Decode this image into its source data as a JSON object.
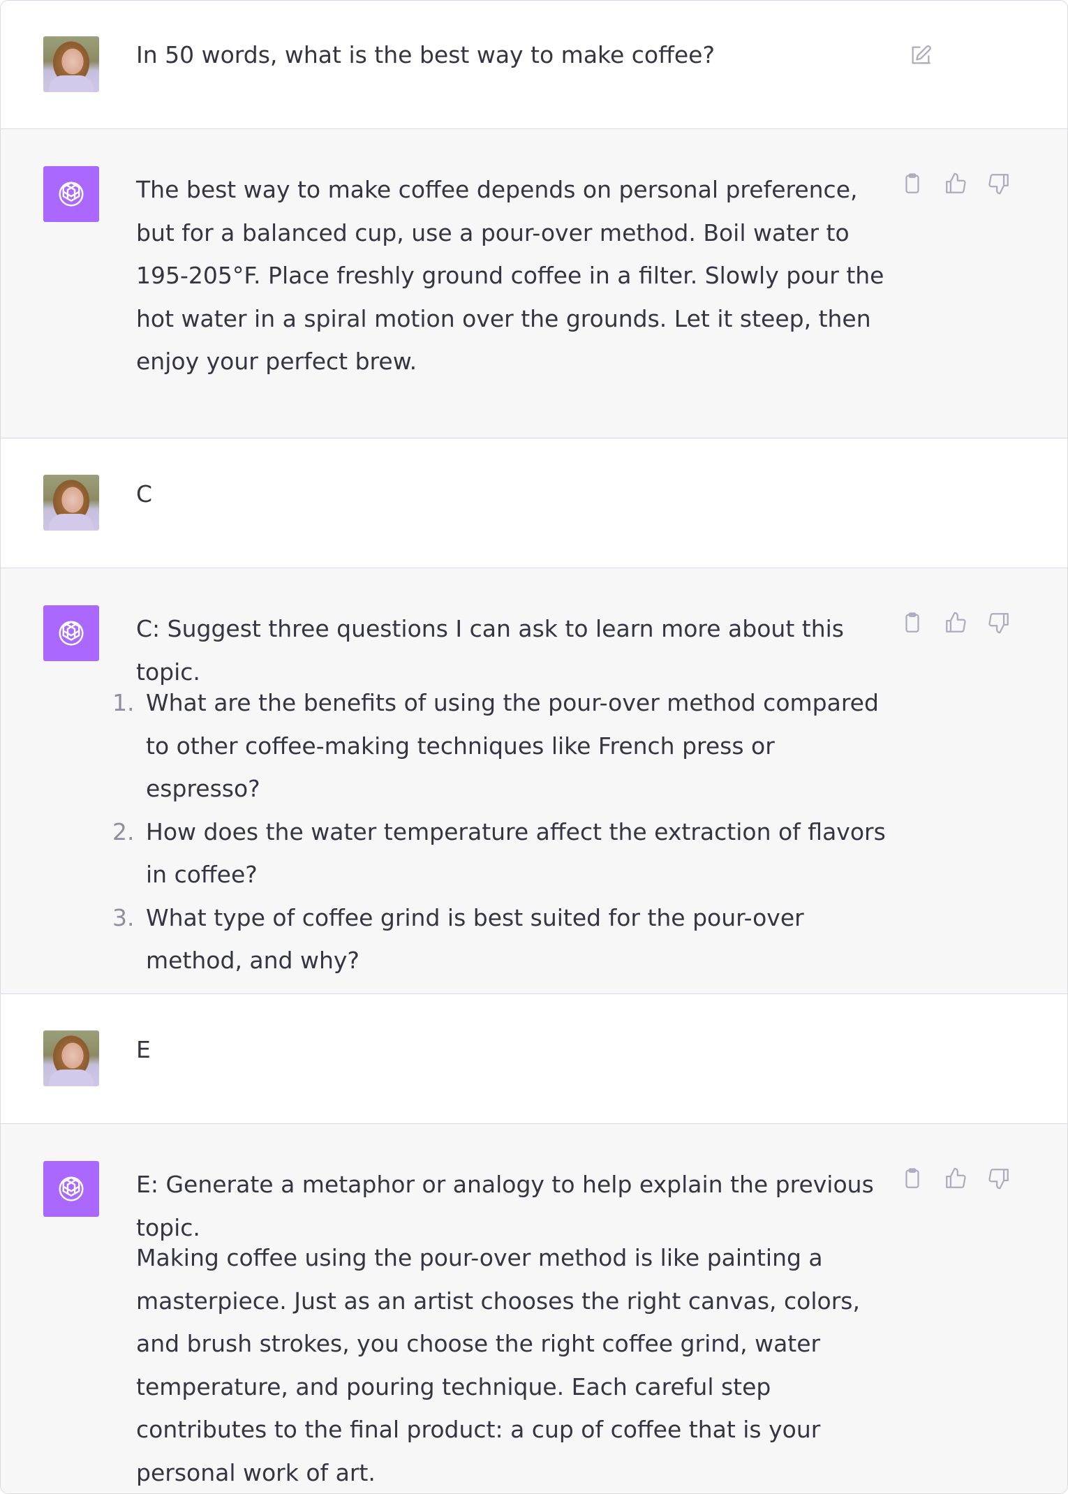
{
  "conversation": [
    {
      "role": "user",
      "text": "In 50 words, what is the best way to make coffee?"
    },
    {
      "role": "assistant",
      "text": "The best way to make coffee depends on personal preference, but for a balanced cup, use a pour-over method. Boil water to 195-205°F. Place freshly ground coffee in a filter. Slowly pour the hot water in a spiral motion over the grounds. Let it steep, then enjoy your perfect brew."
    },
    {
      "role": "user",
      "text": "C"
    },
    {
      "role": "assistant",
      "intro": "C: Suggest three questions I can ask to learn more about this topic.",
      "items": [
        {
          "num": "1.",
          "text": "What are the benefits of using the pour-over method compared to other coffee-making techniques like French press or espresso?"
        },
        {
          "num": "2.",
          "text": "How does the water temperature affect the extraction of flavors in coffee?"
        },
        {
          "num": "3.",
          "text": "What type of coffee grind is best suited for the pour-over method, and why?"
        }
      ]
    },
    {
      "role": "user",
      "text": "E"
    },
    {
      "role": "assistant",
      "intro": "E: Generate a metaphor or analogy to help explain the previous topic.",
      "text": "Making coffee using the pour-over method is like painting a masterpiece. Just as an artist chooses the right canvas, colors, and brush strokes, you choose the right coffee grind, water temperature, and pouring technique. Each careful step contributes to the final product: a cup of coffee that is your personal work of art."
    }
  ],
  "icons": {
    "edit": "edit-icon",
    "copy": "clipboard-icon",
    "like": "thumbs-up-icon",
    "dislike": "thumbs-down-icon",
    "assistant_logo": "openai-logo-icon",
    "user_avatar": "user-avatar"
  },
  "colors": {
    "assistant_bg": "#f7f7f8",
    "user_bg": "#ffffff",
    "assistant_avatar": "#ab68ff",
    "border": "#d9d9e3",
    "icon": "#acacbe"
  }
}
